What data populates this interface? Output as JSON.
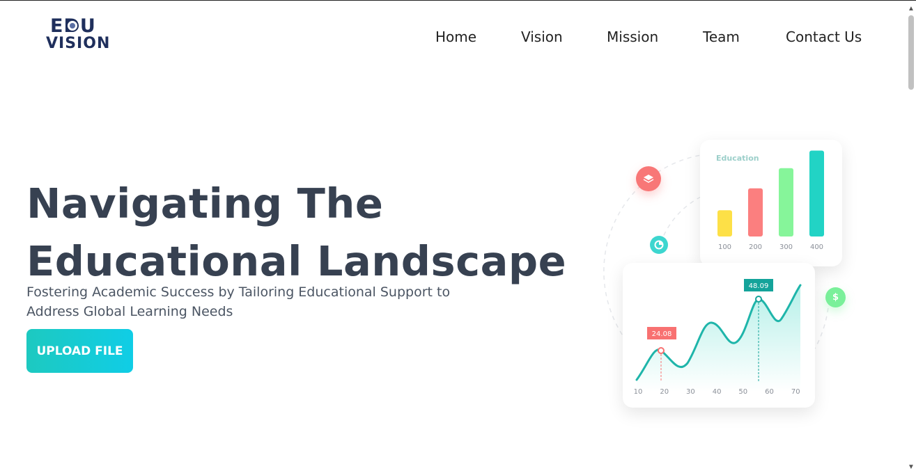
{
  "brand": {
    "logo_line1": "EDU",
    "logo_line2": "VISION"
  },
  "nav": {
    "items": [
      {
        "label": "Home"
      },
      {
        "label": "Vision"
      },
      {
        "label": "Mission"
      },
      {
        "label": "Team"
      },
      {
        "label": "Contact Us"
      }
    ]
  },
  "hero": {
    "title_line1": "Navigating The",
    "title_line2": "Educational Landscape",
    "subtitle_line1": "Fostering Academic Success by Tailoring Educational Support to",
    "subtitle_line2": "Address Global Learning Needs",
    "upload_label": "UPLOAD FILE"
  },
  "illustration": {
    "bar_chart": {
      "title": "Education",
      "categories": [
        "100",
        "200",
        "300",
        "400"
      ],
      "values": [
        0.3,
        0.55,
        0.78,
        0.98
      ],
      "colors": [
        "#fde047",
        "#fb7f7f",
        "#86f59a",
        "#22d3c5"
      ]
    },
    "line_chart": {
      "x_ticks": [
        "10",
        "20",
        "30",
        "40",
        "50",
        "60",
        "70"
      ],
      "markers": [
        {
          "label": "24.08",
          "color": "#f87171"
        },
        {
          "label": "48.09",
          "color": "#14a39a"
        }
      ],
      "line_color": "#1fb5aa"
    },
    "icons": {
      "layers": "layers-icon",
      "pie": "pie-chart-icon",
      "dollar": "$"
    },
    "colors": {
      "layers_bg": "#f87777",
      "pie_bg": "#3dd6cf",
      "dollar_bg": "#7af09a"
    }
  }
}
